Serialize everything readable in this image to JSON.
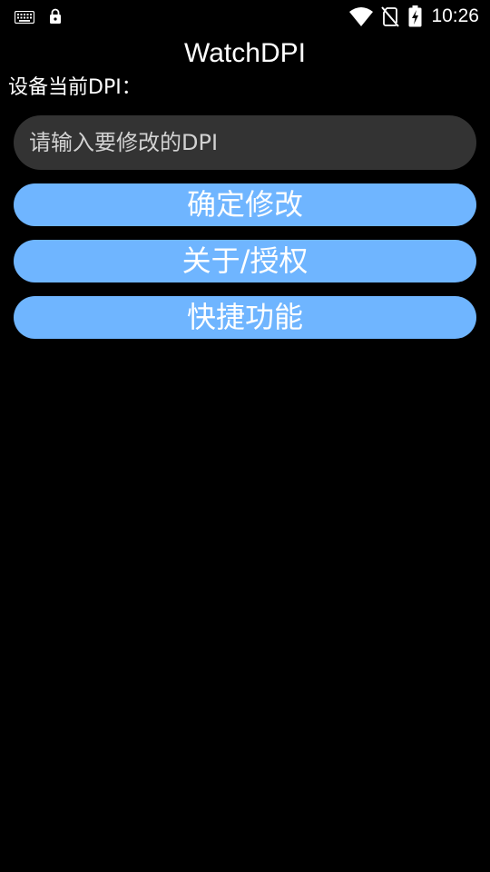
{
  "status_bar": {
    "time": "10:26",
    "icons": [
      "keyboard-icon",
      "lock-icon",
      "wifi-icon",
      "no-sim-icon",
      "battery-charging-icon"
    ]
  },
  "app": {
    "title": "WatchDPI",
    "dpi_label": "设备当前DPI：",
    "dpi_input": {
      "value": "",
      "placeholder": "请输入要修改的DPI"
    },
    "buttons": {
      "confirm": "确定修改",
      "about": "关于/授权",
      "shortcut": "快捷功能"
    }
  },
  "colors": {
    "background": "#000000",
    "input_background": "#333333",
    "button_blue": "#6fb5ff",
    "text": "#ffffff"
  }
}
